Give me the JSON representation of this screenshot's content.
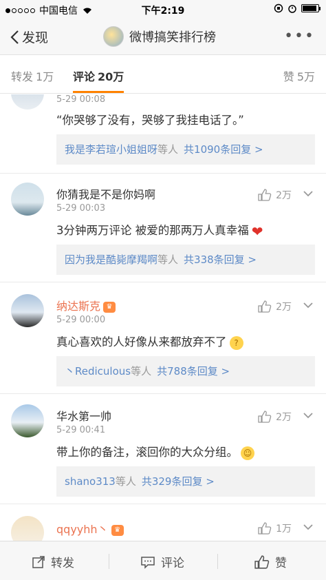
{
  "status_bar": {
    "carrier": "中国电信",
    "time": "下午2:19"
  },
  "nav": {
    "back_label": "发现",
    "title": "微博搞笑排行榜",
    "more": "•••"
  },
  "tabs": {
    "forward": {
      "label": "转发",
      "count": "1万"
    },
    "comment": {
      "label": "评论",
      "count": "20万"
    },
    "like": {
      "label": "赞",
      "count": "5万"
    }
  },
  "comments": [
    {
      "time": "5-29 00:08",
      "text": "“你哭够了没有，哭够了我挂电话了。”",
      "reply_who": "我是李若瑄小姐姐呀",
      "reply_suffix": "等人",
      "reply_count": "共1090条回复 >"
    },
    {
      "name": "你猜我是不是你妈啊",
      "time": "5-29 00:03",
      "text": "3分钟两万评论  被爱的那两万人真幸福",
      "likes": "2万",
      "reply_who": "因为我是酷毙摩羯啊",
      "reply_suffix": "等人",
      "reply_count": "共338条回复 >"
    },
    {
      "name": "纳达斯克",
      "time": "5-29 00:00",
      "text": "真心喜欢的人好像从来都放弃不了",
      "likes": "2万",
      "reply_who": "丶Rediculous",
      "reply_suffix": "等人",
      "reply_count": "共788条回复 >"
    },
    {
      "name": "华水第一帅",
      "time": "5-29 00:41",
      "text": "带上你的备注，滚回你的大众分组。",
      "likes": "2万",
      "reply_who": "shano313",
      "reply_suffix": "等人",
      "reply_count": "共329条回复 >"
    },
    {
      "name": "qqyyhh丶",
      "likes": "1万"
    }
  ],
  "bottom_bar": {
    "forward": "转发",
    "comment": "评论",
    "like": "赞"
  },
  "colors": {
    "accent": "#ff8200",
    "link": "#5d8ac7",
    "vip_name": "#eb7350"
  }
}
